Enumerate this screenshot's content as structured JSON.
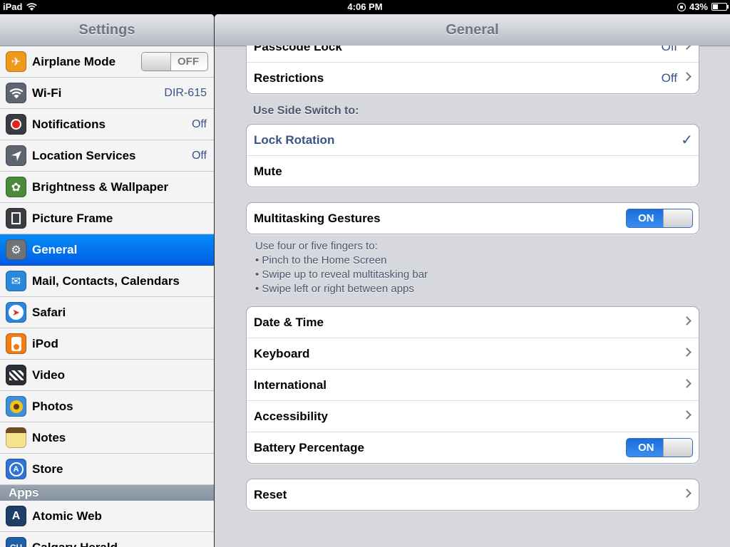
{
  "status_bar": {
    "carrier": "iPad",
    "time": "4:06 PM",
    "battery_text": "43%",
    "battery_level": 0.43
  },
  "master": {
    "title": "Settings",
    "rows": [
      {
        "label": "Airplane Mode",
        "switch": "OFF",
        "icon": "airplane-icon",
        "color": "#f09a1b"
      },
      {
        "label": "Wi-Fi",
        "value": "DIR-615",
        "icon": "wifi-icon",
        "color": "#5e6570"
      },
      {
        "label": "Notifications",
        "value": "Off",
        "icon": "notifications-icon",
        "color": "#383c42"
      },
      {
        "label": "Location Services",
        "value": "Off",
        "icon": "location-icon",
        "color": "#5e6570"
      },
      {
        "label": "Brightness & Wallpaper",
        "icon": "flower-icon",
        "color": "#4b8a3c"
      },
      {
        "label": "Picture Frame",
        "icon": "picture-frame-icon",
        "color": "#3a3d42"
      },
      {
        "label": "General",
        "icon": "gear-icon",
        "color": "#6e737a",
        "selected": true
      },
      {
        "label": "Mail, Contacts, Calendars",
        "icon": "mail-icon",
        "color": "#2a88dc"
      },
      {
        "label": "Safari",
        "icon": "compass-icon",
        "color": "#2b86e0"
      },
      {
        "label": "iPod",
        "icon": "ipod-icon",
        "color": "#f27d12"
      },
      {
        "label": "Video",
        "icon": "clapperboard-icon",
        "color": "#2c2f35"
      },
      {
        "label": "Photos",
        "icon": "sunflower-icon",
        "color": "#3c8fd8"
      },
      {
        "label": "Notes",
        "icon": "notes-icon",
        "color": "#e8c84a"
      },
      {
        "label": "Store",
        "icon": "app-store-icon",
        "color": "#2f74d4"
      }
    ],
    "apps_header": "Apps",
    "app_rows": [
      {
        "label": "Atomic Web",
        "icon": "atomic-web-icon",
        "color": "#1d3e66"
      },
      {
        "label": "Calgary Herald",
        "icon": "calgary-herald-icon",
        "color": "#1f5fa5"
      }
    ]
  },
  "detail": {
    "title": "General",
    "top_group": [
      {
        "label": "Passcode Lock",
        "value": "Off"
      },
      {
        "label": "Restrictions",
        "value": "Off"
      }
    ],
    "side_switch_header": "Use Side Switch to:",
    "side_switch_options": [
      {
        "label": "Lock Rotation",
        "checked": true
      },
      {
        "label": "Mute",
        "checked": false
      }
    ],
    "multitasking": {
      "label": "Multitasking Gestures",
      "switch": "ON"
    },
    "multitasking_footnote": [
      "Use four or five fingers to:",
      "• Pinch to the Home Screen",
      "• Swipe up to reveal multitasking bar",
      "• Swipe left or right between apps"
    ],
    "main_group": [
      {
        "label": "Date & Time"
      },
      {
        "label": "Keyboard"
      },
      {
        "label": "International"
      },
      {
        "label": "Accessibility"
      },
      {
        "label": "Battery Percentage",
        "switch": "ON"
      }
    ],
    "reset_label": "Reset"
  },
  "colors": {
    "selected_row": "#015de6",
    "value_blue": "#385487",
    "switch_on": "#1b6ddb"
  }
}
